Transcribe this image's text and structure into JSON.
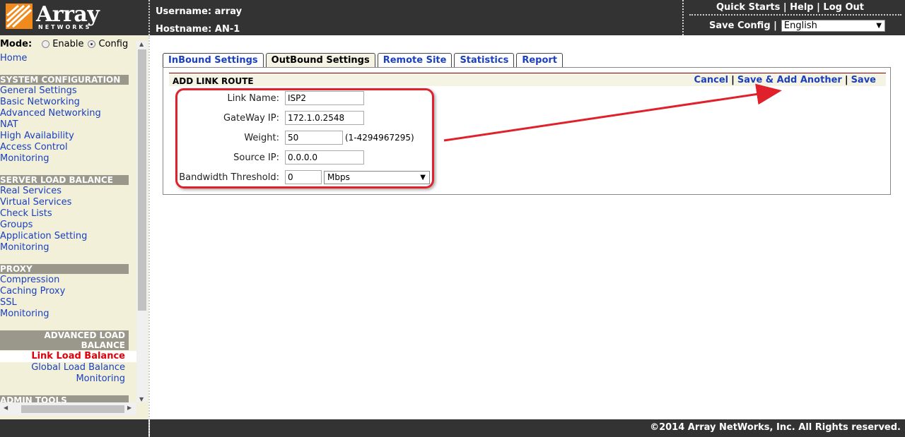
{
  "header": {
    "logo_text": "Array",
    "logo_sub": "NETWORKS",
    "username_label": "Username: array",
    "hostname_label": "Hostname: AN-1",
    "links": [
      "Quick Starts",
      "Help",
      "Log Out"
    ],
    "save_config_label": "Save Config |",
    "language": "English",
    "brand_color": "#f08a1c"
  },
  "sidebar": {
    "mode_label": "Mode:",
    "mode_enable": "Enable",
    "mode_config": "Config",
    "home": "Home",
    "sections": [
      {
        "title": "SYSTEM CONFIGURATION",
        "items": [
          "General Settings",
          "Basic Networking",
          "Advanced Networking",
          "NAT",
          "High Availability",
          "Access Control",
          "Monitoring"
        ]
      },
      {
        "title": "SERVER LOAD BALANCE",
        "items": [
          "Real Services",
          "Virtual Services",
          "Check Lists",
          "Groups",
          "Application Setting",
          "Monitoring"
        ]
      },
      {
        "title": "PROXY",
        "items": [
          "Compression",
          "Caching Proxy",
          "SSL",
          "Monitoring"
        ]
      },
      {
        "title_line1": "ADVANCED LOAD",
        "title_line2": "BALANCE",
        "items": [
          "Link Load Balance",
          "Global Load Balance",
          "Monitoring"
        ]
      },
      {
        "title": "ADMIN TOOLS"
      }
    ]
  },
  "tabs": [
    "InBound Settings",
    "OutBound Settings",
    "Remote Site",
    "Statistics",
    "Report"
  ],
  "panel": {
    "title": "ADD LINK ROUTE",
    "actions": [
      "Cancel",
      "Save & Add Another",
      "Save"
    ]
  },
  "form": {
    "link_name": {
      "label": "Link Name:",
      "value": "ISP2"
    },
    "gateway_ip": {
      "label": "GateWay IP:",
      "value": "172.1.0.2548"
    },
    "weight": {
      "label": "Weight:",
      "value": "50",
      "hint": "(1-4294967295)"
    },
    "source_ip": {
      "label": "Source IP:",
      "value": "0.0.0.0"
    },
    "bandwidth": {
      "label": "Bandwidth Threshold:",
      "value": "0",
      "unit": "Mbps"
    }
  },
  "footer": {
    "copyright": "©2014 Array NetWorks, Inc. All Rights reserved."
  }
}
